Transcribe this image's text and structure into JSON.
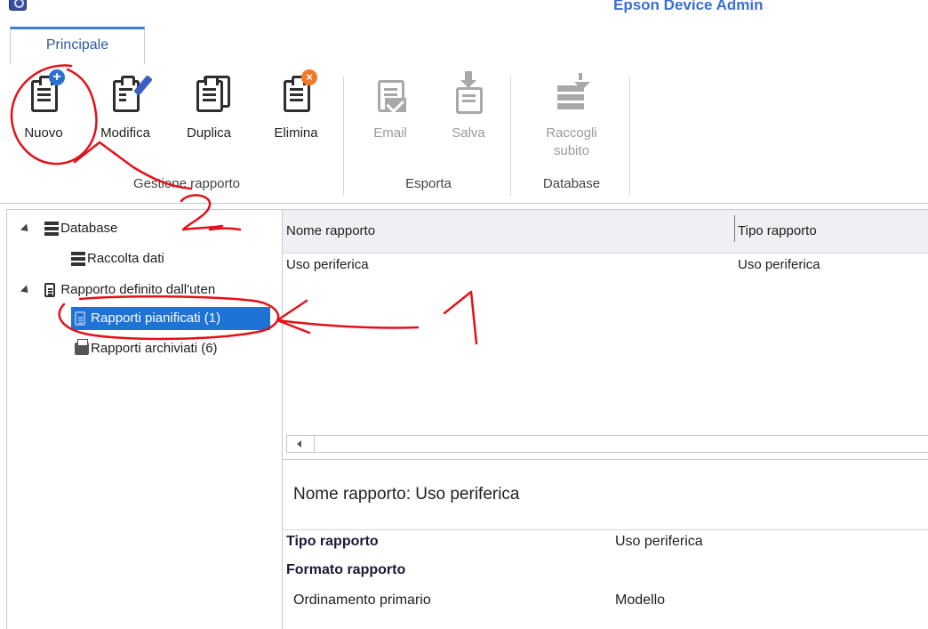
{
  "app": {
    "title": "Epson Device Admin"
  },
  "ribbon": {
    "tab": "Principale",
    "buttons": [
      {
        "label": "Nuovo",
        "enabled": true,
        "icon": "new-report-icon"
      },
      {
        "label": "Modifica",
        "enabled": true,
        "icon": "edit-report-icon"
      },
      {
        "label": "Duplica",
        "enabled": true,
        "icon": "duplicate-report-icon"
      },
      {
        "label": "Elimina",
        "enabled": true,
        "icon": "delete-report-icon"
      },
      {
        "label": "Email",
        "enabled": false,
        "icon": "email-icon"
      },
      {
        "label": "Salva",
        "enabled": false,
        "icon": "save-icon"
      },
      {
        "label": "Raccogli subito",
        "label_line1": "Raccogli",
        "label_line2": "subito",
        "enabled": false,
        "icon": "collect-icon"
      }
    ],
    "groups": [
      {
        "label": "Gestione rapporto"
      },
      {
        "label": "Esporta"
      },
      {
        "label": "Database"
      }
    ]
  },
  "tree": {
    "items": [
      {
        "label": "Database",
        "expanded": true
      },
      {
        "label": "Raccolta dati"
      },
      {
        "label": "Rapporto definito dall'uten",
        "expanded": true
      },
      {
        "label": "Rapporti pianificati (1)",
        "selected": true
      },
      {
        "label": "Rapporti archiviati (6)"
      }
    ]
  },
  "list": {
    "columns": [
      "Nome rapporto",
      "Tipo rapporto"
    ],
    "rows": [
      [
        "Uso periferica",
        "Uso periferica"
      ]
    ]
  },
  "details": {
    "title": "Nome rapporto: Uso periferica",
    "props": [
      {
        "key": "Tipo rapporto",
        "value": "Uso periferica"
      },
      {
        "key": "Formato rapporto",
        "value": ""
      },
      {
        "key": "Ordinamento primario",
        "value": "Modello"
      }
    ]
  },
  "annotations": [
    "1",
    "2"
  ],
  "colors": {
    "accent": "#1e73d7",
    "title": "#3b6fd6",
    "ink": "#e3101a"
  }
}
